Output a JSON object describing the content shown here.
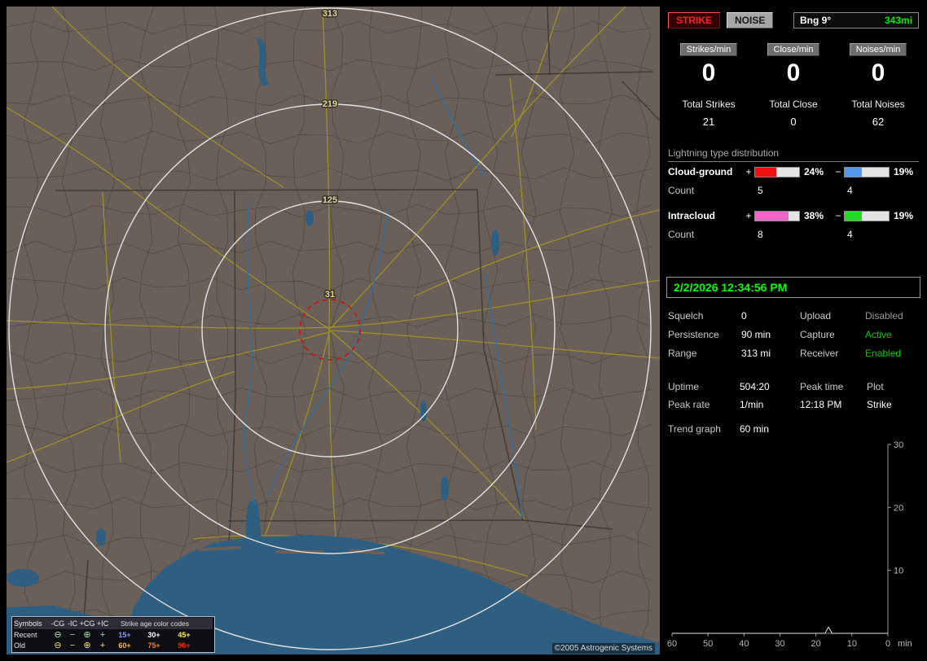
{
  "map": {
    "ring_labels": [
      "313",
      "219",
      "125",
      "31"
    ],
    "copyright": "©2005 Astrogenic Systems",
    "legend": {
      "symbols_header": "Symbols",
      "col_headers": [
        "-CG",
        "-IC",
        "+CG",
        "+IC"
      ],
      "age_header": "Strike age color codes",
      "symbols": [
        "⊖",
        "−",
        "⊕",
        "+"
      ],
      "recent_color": "#9fe89f",
      "old_color": "#f0e060",
      "rows": [
        {
          "label": "Recent",
          "ages": [
            {
              "text": "15+",
              "color": "#8899ff"
            },
            {
              "text": "30+",
              "color": "#ffffff"
            },
            {
              "text": "45+",
              "color": "#ffee55"
            }
          ]
        },
        {
          "label": "Old",
          "ages": [
            {
              "text": "60+",
              "color": "#ffbb22"
            },
            {
              "text": "75+",
              "color": "#ff7711"
            },
            {
              "text": "90+",
              "color": "#ff2211"
            }
          ]
        }
      ]
    }
  },
  "header": {
    "strike_label": "STRIKE",
    "noise_label": "NOISE",
    "bearing_label": "Bng 9°",
    "range_label": "343mi"
  },
  "rates": {
    "items": [
      {
        "label": "Strikes/min",
        "value": "0",
        "total_label": "Total Strikes",
        "total": "21"
      },
      {
        "label": "Close/min",
        "value": "0",
        "total_label": "Total Close",
        "total": "0"
      },
      {
        "label": "Noises/min",
        "value": "0",
        "total_label": "Total Noises",
        "total": "62"
      }
    ]
  },
  "distribution": {
    "title": "Lightning type distribution",
    "signs": {
      "plus": "+",
      "minus": "−"
    },
    "rows": [
      {
        "label": "Cloud-ground",
        "count_label": "Count",
        "pos_pct": "24%",
        "pos_count": "5",
        "pos_color": "#ee1111",
        "pos_fill": 48,
        "neg_pct": "19%",
        "neg_count": "4",
        "neg_color": "#5599ee",
        "neg_fill": 38
      },
      {
        "label": "Intracloud",
        "count_label": "Count",
        "pos_pct": "38%",
        "pos_count": "8",
        "pos_color": "#ee66cc",
        "pos_fill": 76,
        "neg_pct": "19%",
        "neg_count": "4",
        "neg_color": "#22dd22",
        "neg_fill": 38
      }
    ]
  },
  "status": {
    "datetime": "2/2/2026 12:34:56 PM",
    "rows": [
      {
        "l1": "Squelch",
        "v1": "0",
        "l2": "Upload",
        "v2": "Disabled",
        "v2_color": "#9a9a9a"
      },
      {
        "l1": "Persistence",
        "v1": "90 min",
        "l2": "Capture",
        "v2": "Active",
        "v2_color": "#00cc00"
      },
      {
        "l1": "Range",
        "v1": "313 mi",
        "l2": "Receiver",
        "v2": "Enabled",
        "v2_color": "#00cc00"
      }
    ]
  },
  "stats2": {
    "uptime_label": "Uptime",
    "uptime": "504:20",
    "peak_time_label": "Peak time",
    "plot_label": "Plot",
    "peak_rate_label": "Peak rate",
    "peak_rate": "1/min",
    "peak_time": "12:18 PM",
    "plot_value": "Strike",
    "trend_label": "Trend graph",
    "trend_window": "60 min"
  },
  "chart_data": {
    "type": "line",
    "title": "Trend graph",
    "x_label": "min",
    "x_ticks": [
      "60",
      "50",
      "40",
      "30",
      "20",
      "10",
      "0"
    ],
    "y_ticks": [
      "30",
      "20",
      "10"
    ],
    "xlim": [
      60,
      0
    ],
    "ylim": [
      0,
      30
    ],
    "grid": false,
    "legend_position": "none",
    "series": [
      {
        "name": "Strike",
        "x": [
          60,
          17.5,
          16.5,
          15.5,
          0
        ],
        "values": [
          0,
          0,
          1,
          0,
          0
        ]
      }
    ]
  }
}
